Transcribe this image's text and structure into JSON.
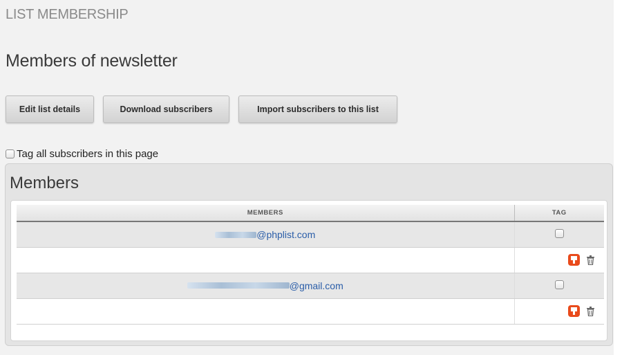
{
  "header": {
    "section_title": "LIST MEMBERSHIP",
    "page_title": "Members of newsletter"
  },
  "toolbar": {
    "edit_label": "Edit list details",
    "download_label": "Download subscribers",
    "import_label": "Import subscribers to this list"
  },
  "tag_all": {
    "label": "Tag all subscribers in this page",
    "checked": false
  },
  "panel": {
    "title": "Members",
    "columns": {
      "members": "MEMBERS",
      "tag": "TAG"
    },
    "rows": [
      {
        "email_visible": "@phplist.com",
        "tagged": false
      },
      {
        "email_visible": "@gmail.com",
        "tagged": false
      }
    ]
  },
  "icons": {
    "unsubscribe": "unsubscribe-icon",
    "delete": "trash-icon"
  },
  "colors": {
    "accent_link": "#2a5da8",
    "unsubscribe_icon": "#e94b1c"
  }
}
